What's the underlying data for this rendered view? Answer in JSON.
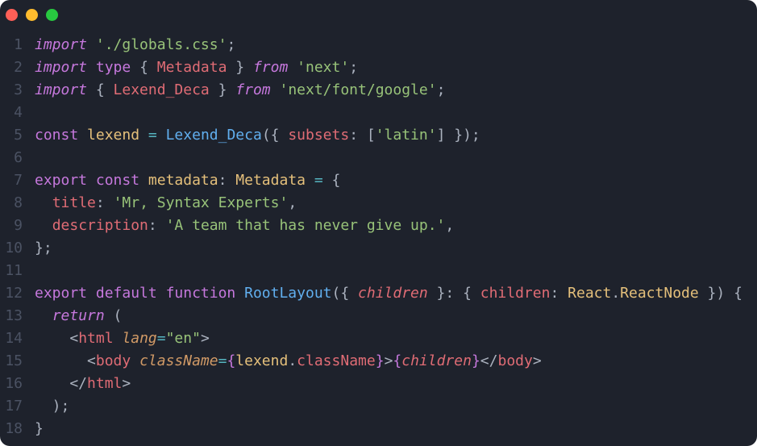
{
  "window": {
    "controls": [
      {
        "name": "close",
        "color": "#ff5f57"
      },
      {
        "name": "minimize",
        "color": "#febc2e"
      },
      {
        "name": "maximize",
        "color": "#28c840"
      }
    ]
  },
  "code": {
    "lines": [
      {
        "num": "1",
        "tokens": [
          {
            "t": "import",
            "k": "kw",
            "i": true
          },
          {
            "t": " ",
            "k": "plain"
          },
          {
            "t": "'./globals.css'",
            "k": "str"
          },
          {
            "t": ";",
            "k": "punc"
          }
        ]
      },
      {
        "num": "2",
        "tokens": [
          {
            "t": "import",
            "k": "kw",
            "i": true
          },
          {
            "t": " ",
            "k": "plain"
          },
          {
            "t": "type",
            "k": "kw"
          },
          {
            "t": " { ",
            "k": "punc"
          },
          {
            "t": "Metadata",
            "k": "type"
          },
          {
            "t": " } ",
            "k": "punc"
          },
          {
            "t": "from",
            "k": "kw",
            "i": true
          },
          {
            "t": " ",
            "k": "plain"
          },
          {
            "t": "'next'",
            "k": "str"
          },
          {
            "t": ";",
            "k": "punc"
          }
        ]
      },
      {
        "num": "3",
        "tokens": [
          {
            "t": "import",
            "k": "kw",
            "i": true
          },
          {
            "t": " { ",
            "k": "punc"
          },
          {
            "t": "Lexend_Deca",
            "k": "type"
          },
          {
            "t": " } ",
            "k": "punc"
          },
          {
            "t": "from",
            "k": "kw",
            "i": true
          },
          {
            "t": " ",
            "k": "plain"
          },
          {
            "t": "'next/font/google'",
            "k": "str"
          },
          {
            "t": ";",
            "k": "punc"
          }
        ]
      },
      {
        "num": "4",
        "tokens": []
      },
      {
        "num": "5",
        "tokens": [
          {
            "t": "const",
            "k": "kw"
          },
          {
            "t": " ",
            "k": "plain"
          },
          {
            "t": "lexend",
            "k": "var"
          },
          {
            "t": " ",
            "k": "plain"
          },
          {
            "t": "=",
            "k": "op"
          },
          {
            "t": " ",
            "k": "plain"
          },
          {
            "t": "Lexend_Deca",
            "k": "fn"
          },
          {
            "t": "({ ",
            "k": "punc"
          },
          {
            "t": "subsets",
            "k": "prop"
          },
          {
            "t": ": [",
            "k": "punc"
          },
          {
            "t": "'latin'",
            "k": "str"
          },
          {
            "t": "] });",
            "k": "punc"
          }
        ]
      },
      {
        "num": "6",
        "tokens": []
      },
      {
        "num": "7",
        "tokens": [
          {
            "t": "export",
            "k": "kw"
          },
          {
            "t": " ",
            "k": "plain"
          },
          {
            "t": "const",
            "k": "kw"
          },
          {
            "t": " ",
            "k": "plain"
          },
          {
            "t": "metadata",
            "k": "var"
          },
          {
            "t": ": ",
            "k": "punc"
          },
          {
            "t": "Metadata",
            "k": "var"
          },
          {
            "t": " ",
            "k": "plain"
          },
          {
            "t": "=",
            "k": "op"
          },
          {
            "t": " {",
            "k": "punc"
          }
        ]
      },
      {
        "num": "8",
        "tokens": [
          {
            "t": "  ",
            "k": "plain"
          },
          {
            "t": "title",
            "k": "prop"
          },
          {
            "t": ": ",
            "k": "punc"
          },
          {
            "t": "'Mr, Syntax Experts'",
            "k": "str"
          },
          {
            "t": ",",
            "k": "punc"
          }
        ]
      },
      {
        "num": "9",
        "tokens": [
          {
            "t": "  ",
            "k": "plain"
          },
          {
            "t": "description",
            "k": "prop"
          },
          {
            "t": ": ",
            "k": "punc"
          },
          {
            "t": "'A team that has never give up.'",
            "k": "str"
          },
          {
            "t": ",",
            "k": "punc"
          }
        ]
      },
      {
        "num": "10",
        "tokens": [
          {
            "t": "};",
            "k": "punc"
          }
        ]
      },
      {
        "num": "11",
        "tokens": []
      },
      {
        "num": "12",
        "tokens": [
          {
            "t": "export",
            "k": "kw"
          },
          {
            "t": " ",
            "k": "plain"
          },
          {
            "t": "default",
            "k": "kw"
          },
          {
            "t": " ",
            "k": "plain"
          },
          {
            "t": "function",
            "k": "kw"
          },
          {
            "t": " ",
            "k": "plain"
          },
          {
            "t": "RootLayout",
            "k": "fn"
          },
          {
            "t": "({ ",
            "k": "punc"
          },
          {
            "t": "children",
            "k": "prop",
            "i": true
          },
          {
            "t": " }: { ",
            "k": "punc"
          },
          {
            "t": "children",
            "k": "prop"
          },
          {
            "t": ": ",
            "k": "punc"
          },
          {
            "t": "React",
            "k": "var"
          },
          {
            "t": ".",
            "k": "punc"
          },
          {
            "t": "ReactNode",
            "k": "var"
          },
          {
            "t": " }) {",
            "k": "punc"
          }
        ]
      },
      {
        "num": "13",
        "tokens": [
          {
            "t": "  ",
            "k": "plain"
          },
          {
            "t": "return",
            "k": "kw",
            "i": true
          },
          {
            "t": " (",
            "k": "punc"
          }
        ]
      },
      {
        "num": "14",
        "tokens": [
          {
            "t": "    <",
            "k": "punc"
          },
          {
            "t": "html",
            "k": "tag"
          },
          {
            "t": " ",
            "k": "plain"
          },
          {
            "t": "lang",
            "k": "attr",
            "i": true
          },
          {
            "t": "=",
            "k": "op"
          },
          {
            "t": "\"en\"",
            "k": "str"
          },
          {
            "t": ">",
            "k": "punc"
          }
        ]
      },
      {
        "num": "15",
        "tokens": [
          {
            "t": "      <",
            "k": "punc"
          },
          {
            "t": "body",
            "k": "tag"
          },
          {
            "t": " ",
            "k": "plain"
          },
          {
            "t": "className",
            "k": "attr",
            "i": true
          },
          {
            "t": "=",
            "k": "op"
          },
          {
            "t": "{",
            "k": "kw"
          },
          {
            "t": "lexend",
            "k": "var"
          },
          {
            "t": ".",
            "k": "punc"
          },
          {
            "t": "className",
            "k": "prop"
          },
          {
            "t": "}",
            "k": "kw"
          },
          {
            "t": ">",
            "k": "punc"
          },
          {
            "t": "{",
            "k": "kw"
          },
          {
            "t": "children",
            "k": "prop",
            "i": true
          },
          {
            "t": "}",
            "k": "kw"
          },
          {
            "t": "</",
            "k": "punc"
          },
          {
            "t": "body",
            "k": "tag"
          },
          {
            "t": ">",
            "k": "punc"
          }
        ]
      },
      {
        "num": "16",
        "tokens": [
          {
            "t": "    </",
            "k": "punc"
          },
          {
            "t": "html",
            "k": "tag"
          },
          {
            "t": ">",
            "k": "punc"
          }
        ]
      },
      {
        "num": "17",
        "tokens": [
          {
            "t": "  );",
            "k": "punc"
          }
        ]
      },
      {
        "num": "18",
        "tokens": [
          {
            "t": "}",
            "k": "punc"
          }
        ]
      }
    ]
  }
}
